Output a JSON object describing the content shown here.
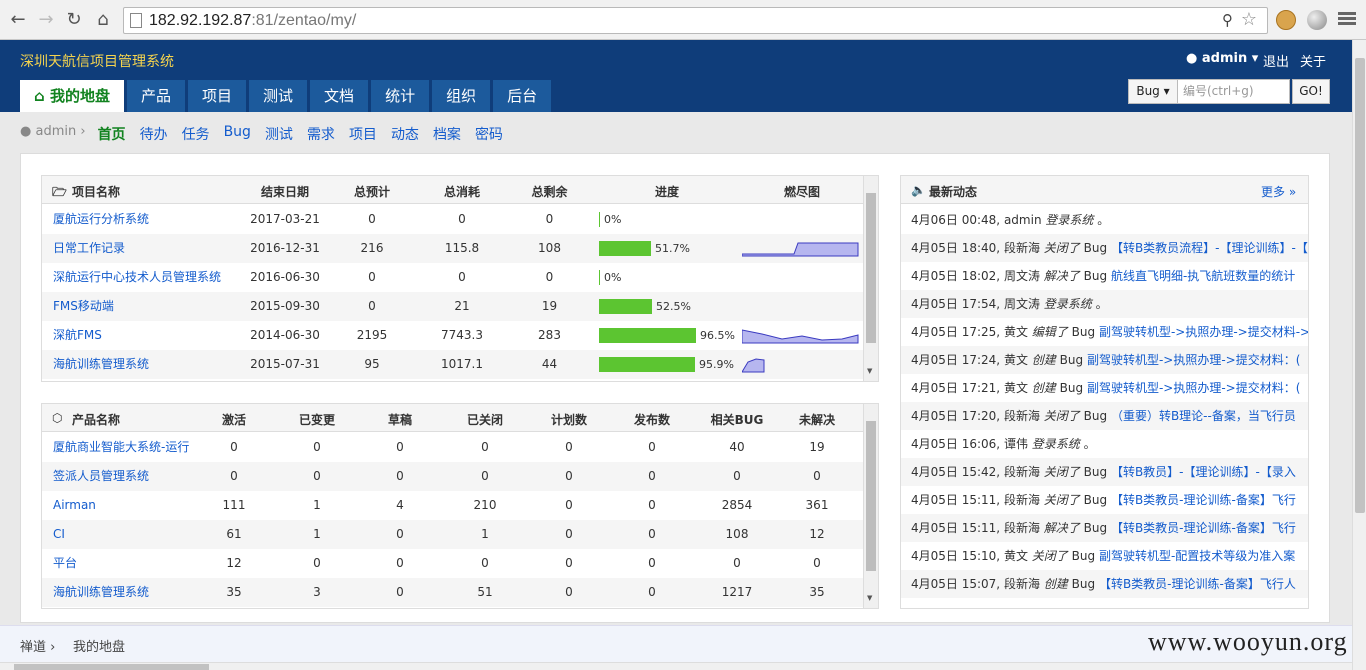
{
  "browser": {
    "url_host": "182.92.192.87",
    "url_rest": ":81/zentao/my/"
  },
  "header": {
    "brand": "深圳天航信项目管理系统",
    "user": "admin",
    "logout": "退出",
    "about": "关于",
    "nav": [
      "我的地盘",
      "产品",
      "项目",
      "测试",
      "文档",
      "统计",
      "组织",
      "后台"
    ],
    "search": {
      "type": "Bug",
      "placeholder": "编号(ctrl+g)",
      "go": "GO!"
    }
  },
  "subnav": {
    "crumb": "admin",
    "items": [
      "首页",
      "待办",
      "任务",
      "Bug",
      "测试",
      "需求",
      "项目",
      "动态",
      "档案",
      "密码"
    ]
  },
  "projects": {
    "headers": [
      "项目名称",
      "结束日期",
      "总预计",
      "总消耗",
      "总剩余",
      "进度",
      "燃尽图"
    ],
    "rows": [
      {
        "name": "厦航运行分析系统",
        "end": "2017-03-21",
        "estimate": "0",
        "consumed": "0",
        "left": "0",
        "progress": "0%",
        "pct": 0
      },
      {
        "name": "日常工作记录",
        "end": "2016-12-31",
        "estimate": "216",
        "consumed": "115.8",
        "left": "108",
        "progress": "51.7%",
        "pct": 51.7
      },
      {
        "name": "深航运行中心技术人员管理系统",
        "end": "2016-06-30",
        "estimate": "0",
        "consumed": "0",
        "left": "0",
        "progress": "0%",
        "pct": 0
      },
      {
        "name": "FMS移动端",
        "end": "2015-09-30",
        "estimate": "0",
        "consumed": "21",
        "left": "19",
        "progress": "52.5%",
        "pct": 52.5
      },
      {
        "name": "深航FMS",
        "end": "2014-06-30",
        "estimate": "2195",
        "consumed": "7743.3",
        "left": "283",
        "progress": "96.5%",
        "pct": 96.5
      },
      {
        "name": "海航训练管理系统",
        "end": "2015-07-31",
        "estimate": "95",
        "consumed": "1017.1",
        "left": "44",
        "progress": "95.9%",
        "pct": 95.9
      }
    ]
  },
  "products": {
    "headers": [
      "产品名称",
      "激活",
      "已变更",
      "草稿",
      "已关闭",
      "计划数",
      "发布数",
      "相关BUG",
      "未解决"
    ],
    "rows": [
      {
        "name": "厦航商业智能大系统-运行",
        "v": [
          "0",
          "0",
          "0",
          "0",
          "0",
          "0",
          "40",
          "19"
        ]
      },
      {
        "name": "签派人员管理系统",
        "v": [
          "0",
          "0",
          "0",
          "0",
          "0",
          "0",
          "0",
          "0"
        ]
      },
      {
        "name": "Airman",
        "v": [
          "111",
          "1",
          "4",
          "210",
          "0",
          "0",
          "2854",
          "361"
        ]
      },
      {
        "name": "CI",
        "v": [
          "61",
          "1",
          "0",
          "1",
          "0",
          "0",
          "108",
          "12"
        ]
      },
      {
        "name": "平台",
        "v": [
          "12",
          "0",
          "0",
          "0",
          "0",
          "0",
          "0",
          "0"
        ]
      },
      {
        "name": "海航训练管理系统",
        "v": [
          "35",
          "3",
          "0",
          "51",
          "0",
          "0",
          "1217",
          "35"
        ]
      }
    ]
  },
  "activity": {
    "title": "最新动态",
    "more": "更多",
    "items": [
      {
        "time": "4月06日 00:48,",
        "actor": "admin",
        "action": "登录系统",
        "object": "。"
      },
      {
        "time": "4月05日 18:40,",
        "actor": "段新海",
        "action": "关闭了",
        "type": "Bug",
        "object": "【转B类教员流程】-【理论训练】-【"
      },
      {
        "time": "4月05日 18:02,",
        "actor": "周文涛",
        "action": "解决了",
        "type": "Bug",
        "object": "航线直飞明细-执飞航班数量的统计"
      },
      {
        "time": "4月05日 17:54,",
        "actor": "周文涛",
        "action": "登录系统",
        "object": "。"
      },
      {
        "time": "4月05日 17:25,",
        "actor": "黄文",
        "action": "编辑了",
        "type": "Bug",
        "object": "副驾驶转机型->执照办理->提交材料->"
      },
      {
        "time": "4月05日 17:24,",
        "actor": "黄文",
        "action": "创建",
        "type": "Bug",
        "object": "副驾驶转机型->执照办理->提交材料：("
      },
      {
        "time": "4月05日 17:21,",
        "actor": "黄文",
        "action": "创建",
        "type": "Bug",
        "object": "副驾驶转机型->执照办理->提交材料：("
      },
      {
        "time": "4月05日 17:20,",
        "actor": "段新海",
        "action": "关闭了",
        "type": "Bug",
        "object": "（重要）转B理论--备案，当飞行员"
      },
      {
        "time": "4月05日 16:06,",
        "actor": "谭伟",
        "action": "登录系统",
        "object": "。"
      },
      {
        "time": "4月05日 15:42,",
        "actor": "段新海",
        "action": "关闭了",
        "type": "Bug",
        "object": "【转B教员】-【理论训练】-【录入"
      },
      {
        "time": "4月05日 15:11,",
        "actor": "段新海",
        "action": "关闭了",
        "type": "Bug",
        "object": "【转B类教员-理论训练-备案】飞行"
      },
      {
        "time": "4月05日 15:11,",
        "actor": "段新海",
        "action": "解决了",
        "type": "Bug",
        "object": "【转B类教员-理论训练-备案】飞行"
      },
      {
        "time": "4月05日 15:10,",
        "actor": "黄文",
        "action": "关闭了",
        "type": "Bug",
        "object": "副驾驶转机型-配置技术等级为准入案"
      },
      {
        "time": "4月05日 15:07,",
        "actor": "段新海",
        "action": "创建",
        "type": "Bug",
        "object": "【转B类教员-理论训练-备案】飞行人"
      }
    ]
  },
  "footer": {
    "crumbs": [
      "禅道",
      "我的地盘"
    ],
    "watermark": "www.wooyun.org"
  },
  "colors": {
    "header": "#0f3d7a",
    "tab": "#1c5a9c",
    "progress": "#5cc531",
    "link": "#145ccd",
    "active": "#128320"
  }
}
